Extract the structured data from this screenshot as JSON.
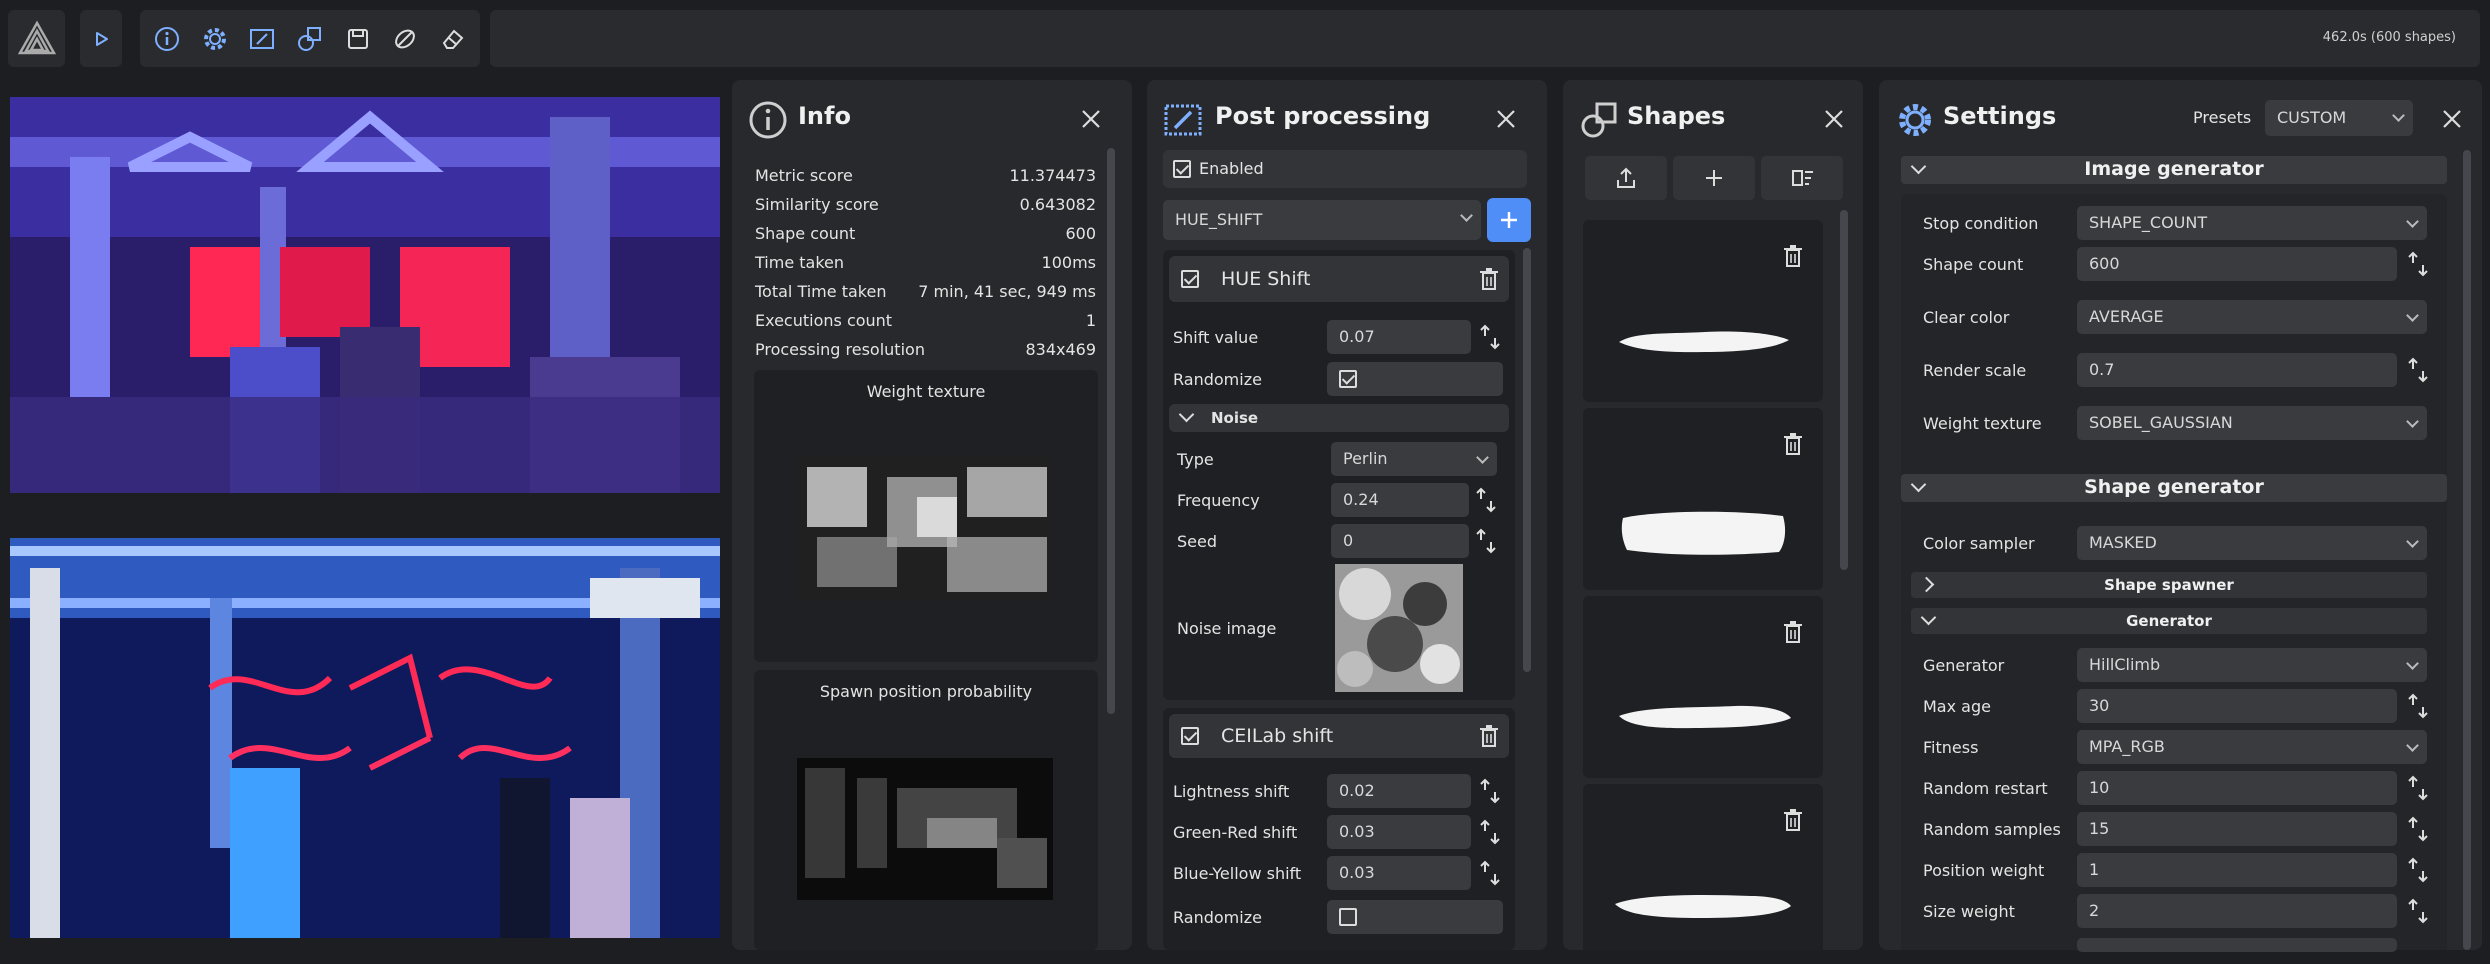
{
  "topbar": {
    "status": "462.0s (600 shapes)",
    "buttons": [
      "play-icon",
      "info-icon",
      "gear-icon",
      "image-edit-icon",
      "shapes-icon",
      "save-icon",
      "brush-icon",
      "eraser-icon"
    ]
  },
  "info": {
    "title": "Info",
    "rows": [
      {
        "label": "Metric score",
        "value": "11.374473"
      },
      {
        "label": "Similarity score",
        "value": "0.643082"
      },
      {
        "label": "Shape count",
        "value": "600"
      },
      {
        "label": "Time taken",
        "value": "100ms"
      },
      {
        "label": "Total Time taken",
        "value": "7 min, 41 sec, 949 ms"
      },
      {
        "label": "Executions count",
        "value": "1"
      },
      {
        "label": "Processing resolution",
        "value": "834x469"
      }
    ],
    "weight_texture_label": "Weight texture",
    "spawn_label": "Spawn position probability"
  },
  "post": {
    "title": "Post processing",
    "enabled_label": "Enabled",
    "effect_select": "HUE_SHIFT",
    "hue": {
      "title": "HUE Shift",
      "shift_label": "Shift value",
      "shift_value": "0.07",
      "randomize_label": "Randomize",
      "noise_label": "Noise",
      "type_label": "Type",
      "type_value": "Perlin",
      "freq_label": "Frequency",
      "freq_value": "0.24",
      "seed_label": "Seed",
      "seed_value": "0",
      "noise_image_label": "Noise  image"
    },
    "cielab": {
      "title": "CEILab shift",
      "light_label": "Lightness shift",
      "light_value": "0.02",
      "gr_label": "Green-Red shift",
      "gr_value": "0.03",
      "by_label": "Blue-Yellow shift",
      "by_value": "0.03",
      "randomize_label": "Randomize"
    }
  },
  "shapes": {
    "title": "Shapes"
  },
  "settings": {
    "title": "Settings",
    "presets_label": "Presets",
    "presets_value": "CUSTOM",
    "image_generator": "Image generator",
    "stop_label": "Stop condition",
    "stop_value": "SHAPE_COUNT",
    "count_label": "Shape count",
    "count_value": "600",
    "clear_label": "Clear color",
    "clear_value": "AVERAGE",
    "scale_label": "Render scale",
    "scale_value": "0.7",
    "weight_label": "Weight texture",
    "weight_value": "SOBEL_GAUSSIAN",
    "shape_generator": "Shape generator",
    "sampler_label": "Color sampler",
    "sampler_value": "MASKED",
    "spawner": "Shape spawner",
    "generator_section": "Generator",
    "gen_label": "Generator",
    "gen_value": "HillClimb",
    "maxage_label": "Max age",
    "maxage_value": "30",
    "fitness_label": "Fitness",
    "fitness_value": "MPA_RGB",
    "restart_label": "Random restart",
    "restart_value": "10",
    "samples_label": "Random samples",
    "samples_value": "15",
    "pos_label": "Position weight",
    "pos_value": "1",
    "size_label": "Size weight",
    "size_value": "2"
  },
  "colors": {
    "accent": "#4f8ef7",
    "panel": "#28292c",
    "background": "#1d1e21"
  }
}
